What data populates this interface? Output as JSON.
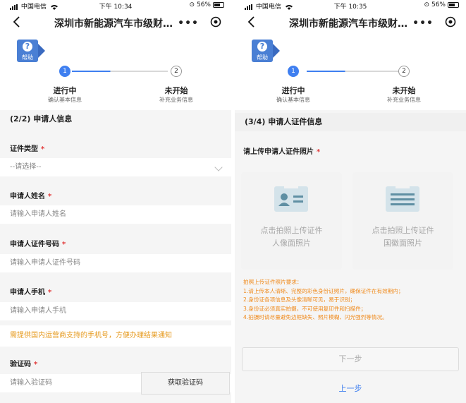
{
  "screen1": {
    "status": {
      "carrier": "中国电信",
      "time": "下午 10:34",
      "battery": "56%"
    },
    "nav": {
      "title": "深圳市新能源汽车市级财…",
      "more": "•••"
    },
    "help_label": "帮助",
    "steps": [
      {
        "num": "1",
        "title": "进行中",
        "sub": "确认基本信息"
      },
      {
        "num": "2",
        "title": "未开始",
        "sub": "补充业务信息"
      }
    ],
    "section_title": "(2/2)  申请人信息",
    "fields": {
      "doc_type": {
        "label": "证件类型",
        "value": "--请选择--"
      },
      "name": {
        "label": "申请人姓名",
        "placeholder": "请输入申请人姓名"
      },
      "id_number": {
        "label": "申请人证件号码",
        "placeholder": "请输入申请人证件号码"
      },
      "phone": {
        "label": "申请人手机",
        "placeholder": "请输入申请人手机"
      },
      "code": {
        "label": "验证码",
        "placeholder": "请输入验证码",
        "button": "获取验证码"
      }
    },
    "required_mark": "*",
    "phone_warning": "需提供国内运营商支持的手机号，方便办理结果通知"
  },
  "screen2": {
    "status": {
      "carrier": "中国电信",
      "time": "下午 10:35",
      "battery": "56%"
    },
    "nav": {
      "title": "深圳市新能源汽车市级财…",
      "more": "•••"
    },
    "help_label": "帮助",
    "steps": [
      {
        "num": "1",
        "title": "进行中",
        "sub": "确认基本信息"
      },
      {
        "num": "2",
        "title": "未开始",
        "sub": "补充业务信息"
      }
    ],
    "section_title": "(3/4)  申请人证件信息",
    "upload_label": "请上传申请人证件照片",
    "required_mark": "*",
    "cards": [
      {
        "line1": "点击拍照上传证件",
        "line2": "人像面照片"
      },
      {
        "line1": "点击拍照上传证件",
        "line2": "国徽面照片"
      }
    ],
    "notes": [
      "拍照上传证件照片要求：",
      "1.请上传本人清晰、完整的彩色身份证照片，确保证件在有效期内；",
      "2.身份证各项信息及头像清晰可见，易于识别；",
      "3.身份证必须真实拍摄，不可使用复印件和扫描件；",
      "4.拍摄时请尽量避免边框缺失、照片模糊、闪光强烈等情况。"
    ],
    "buttons": {
      "next": "下一步",
      "prev": "上一步"
    }
  }
}
